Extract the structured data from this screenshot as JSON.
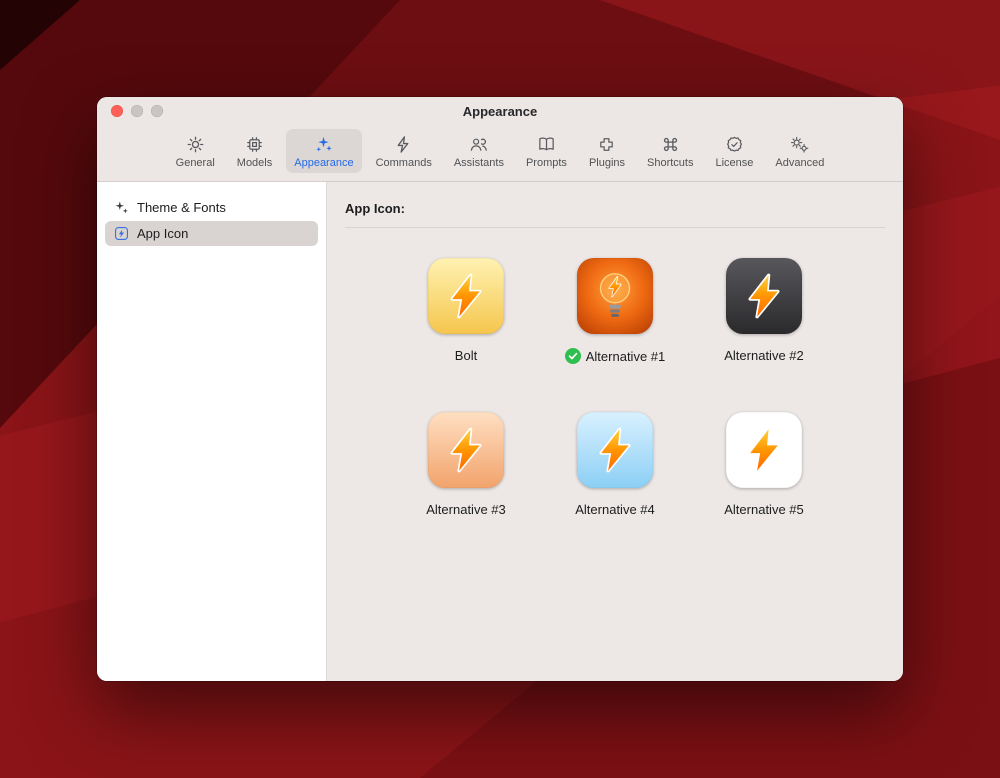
{
  "window": {
    "title": "Appearance"
  },
  "toolbar": {
    "tabs": [
      {
        "label": "General",
        "icon": "gear-icon",
        "active": false
      },
      {
        "label": "Models",
        "icon": "chip-icon",
        "active": false
      },
      {
        "label": "Appearance",
        "icon": "sparkle-wand-icon",
        "active": true
      },
      {
        "label": "Commands",
        "icon": "bolt-outline-icon",
        "active": false
      },
      {
        "label": "Assistants",
        "icon": "people-icon",
        "active": false
      },
      {
        "label": "Prompts",
        "icon": "book-icon",
        "active": false
      },
      {
        "label": "Plugins",
        "icon": "puzzle-icon",
        "active": false
      },
      {
        "label": "Shortcuts",
        "icon": "command-icon",
        "active": false
      },
      {
        "label": "License",
        "icon": "seal-check-icon",
        "active": false
      },
      {
        "label": "Advanced",
        "icon": "gears-icon",
        "active": false
      }
    ]
  },
  "sidebar": {
    "items": [
      {
        "label": "Theme & Fonts",
        "icon": "sparkles-icon",
        "selected": false
      },
      {
        "label": "App Icon",
        "icon": "bolt-app-icon",
        "selected": true
      }
    ]
  },
  "content": {
    "section_label": "App Icon:",
    "icons": [
      {
        "label": "Bolt",
        "variant": "yellow",
        "selected": false
      },
      {
        "label": "Alternative #1",
        "variant": "orange-bulb",
        "selected": true
      },
      {
        "label": "Alternative #2",
        "variant": "dark",
        "selected": false
      },
      {
        "label": "Alternative #3",
        "variant": "peach",
        "selected": false
      },
      {
        "label": "Alternative #4",
        "variant": "blue",
        "selected": false
      },
      {
        "label": "Alternative #5",
        "variant": "white",
        "selected": false
      }
    ]
  },
  "colors": {
    "accent_blue": "#2569e8",
    "selected_green": "#2fbf4f",
    "close_red": "#ff5f57",
    "wallpaper_red": "#8a1417"
  }
}
